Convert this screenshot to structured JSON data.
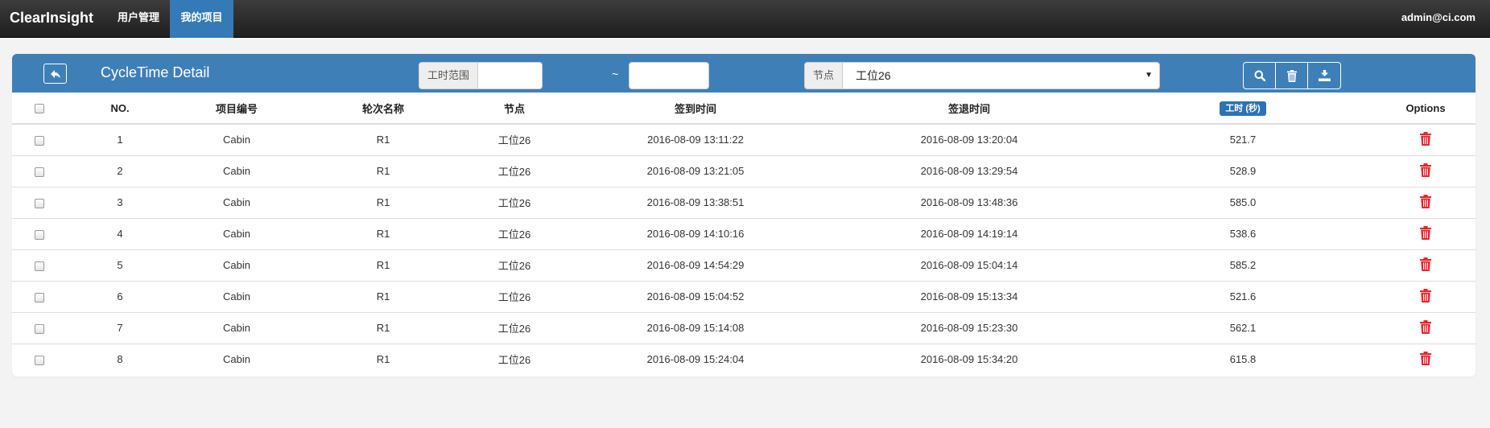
{
  "nav": {
    "brand": "ClearInsight",
    "items": [
      {
        "label": "用户管理"
      },
      {
        "label": "我的项目"
      }
    ],
    "user": "admin@ci.com"
  },
  "panel": {
    "title": "CycleTime Detail",
    "filters": {
      "range_label": "工时范围",
      "range_start": "",
      "range_separator": "~",
      "range_end": "",
      "node_label": "节点",
      "node_value": "工位26"
    },
    "toolbar": [
      "search-icon",
      "trash-icon",
      "export-icon"
    ]
  },
  "colors": {
    "accent": "#3f7fb8",
    "badge": "#2d73b3",
    "danger": "#e8262e"
  },
  "table": {
    "columns": [
      "NO.",
      "项目编号",
      "轮次名称",
      "节点",
      "签到时间",
      "签退时间",
      "工时 (秒)",
      "Options"
    ],
    "rows": [
      [
        "1",
        "Cabin",
        "R1",
        "工位26",
        "2016-08-09 13:11:22",
        "2016-08-09 13:20:04",
        "521.7"
      ],
      [
        "2",
        "Cabin",
        "R1",
        "工位26",
        "2016-08-09 13:21:05",
        "2016-08-09 13:29:54",
        "528.9"
      ],
      [
        "3",
        "Cabin",
        "R1",
        "工位26",
        "2016-08-09 13:38:51",
        "2016-08-09 13:48:36",
        "585.0"
      ],
      [
        "4",
        "Cabin",
        "R1",
        "工位26",
        "2016-08-09 14:10:16",
        "2016-08-09 14:19:14",
        "538.6"
      ],
      [
        "5",
        "Cabin",
        "R1",
        "工位26",
        "2016-08-09 14:54:29",
        "2016-08-09 15:04:14",
        "585.2"
      ],
      [
        "6",
        "Cabin",
        "R1",
        "工位26",
        "2016-08-09 15:04:52",
        "2016-08-09 15:13:34",
        "521.6"
      ],
      [
        "7",
        "Cabin",
        "R1",
        "工位26",
        "2016-08-09 15:14:08",
        "2016-08-09 15:23:30",
        "562.1"
      ],
      [
        "8",
        "Cabin",
        "R1",
        "工位26",
        "2016-08-09 15:24:04",
        "2016-08-09 15:34:20",
        "615.8"
      ]
    ]
  }
}
